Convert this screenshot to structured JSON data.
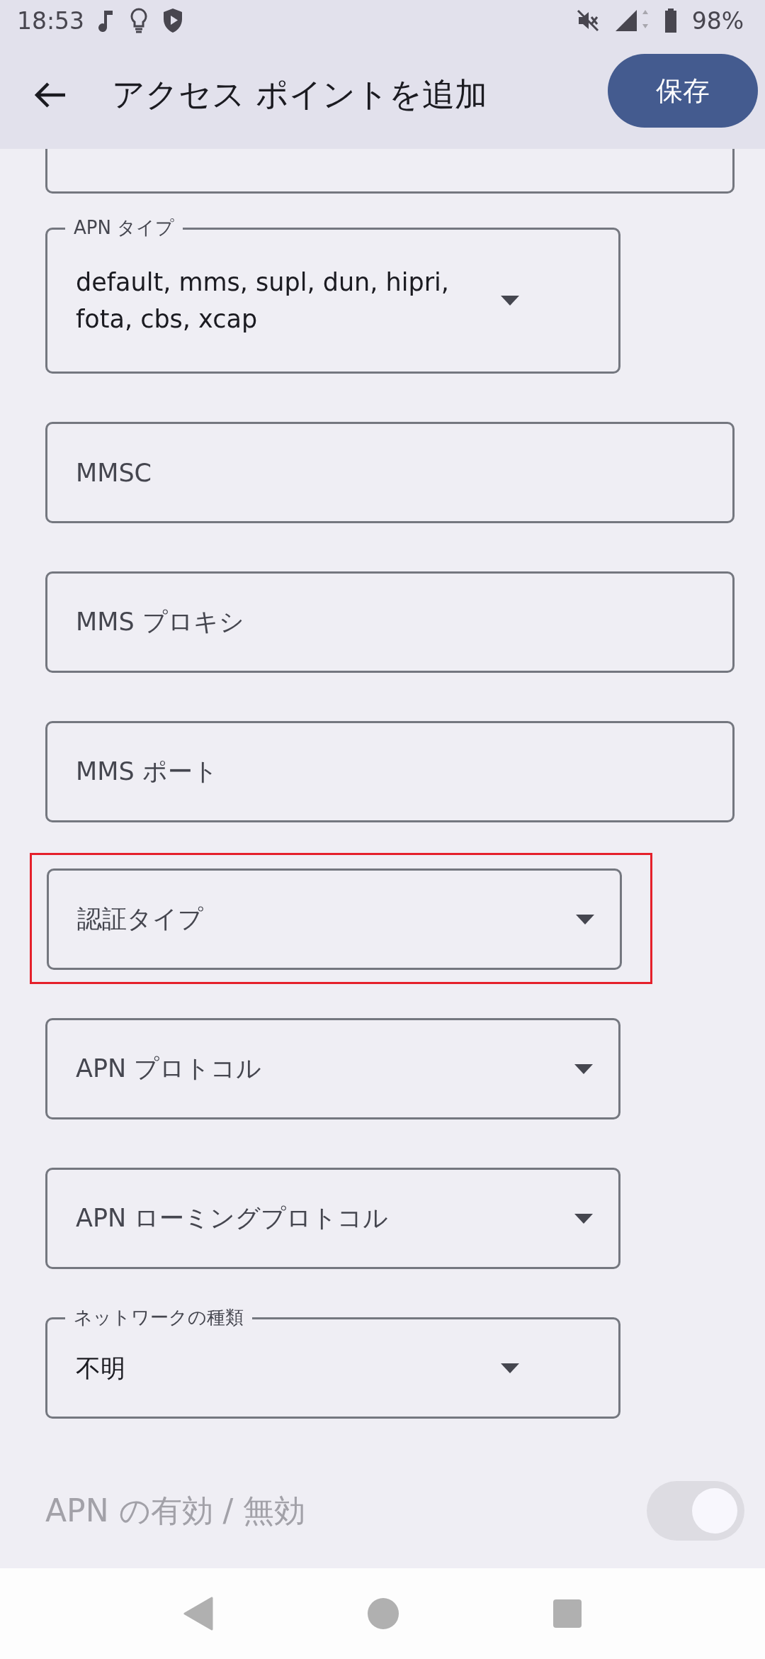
{
  "status_bar": {
    "time": "18:53",
    "battery": "98%"
  },
  "app_bar": {
    "title": "アクセス ポイントを追加",
    "save": "保存"
  },
  "fields": [
    {
      "kind": "cut"
    },
    {
      "kind": "dropdown",
      "label": "APN タイプ",
      "value": "default, mms, supl, dun, hipri, fota, cbs, xcap",
      "highlighted": false
    },
    {
      "kind": "text",
      "label": "MMSC",
      "highlighted": false
    },
    {
      "kind": "text",
      "label": "MMS プロキシ",
      "highlighted": false
    },
    {
      "kind": "text",
      "label": "MMS ポート",
      "highlighted": false
    },
    {
      "kind": "dropdown",
      "label": "認証タイプ",
      "highlighted": true
    },
    {
      "kind": "dropdown",
      "label": "APN プロトコル",
      "highlighted": false
    },
    {
      "kind": "dropdown",
      "label": "APN ローミングプロトコル",
      "highlighted": false
    },
    {
      "kind": "dropdown",
      "label": "ネットワークの種類",
      "value": "不明",
      "highlighted": false
    }
  ],
  "toggle": {
    "label": "APN の有効 / 無効",
    "on": true,
    "disabled": true
  }
}
